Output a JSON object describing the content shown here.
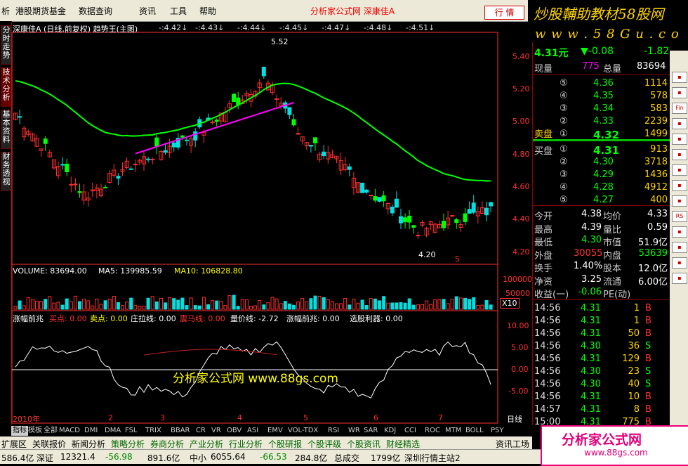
{
  "menu": {
    "items": [
      "析",
      "港股期货基金",
      "数据查询",
      "资讯",
      "工具",
      "帮助"
    ],
    "brand": "分析家公式网  深康佳A",
    "quote_button": "行 情",
    "sys_buttons": [
      "_",
      "□",
      "×"
    ]
  },
  "logo": {
    "title": "炒股輔助教材58股网",
    "url": "w w w . 5 8 G u . c o m"
  },
  "left_tabs": [
    "分时走势",
    "技术分析",
    "基本资料",
    "财务透视"
  ],
  "main_chart": {
    "header": "深康佳A (日线,前复权) 趋势王(主图)",
    "marks": [
      "-:4.42↓",
      "-:4.43↓",
      "-:4.44↓",
      "-:4.45↓",
      "-:4.47↓",
      "-:4.48↓",
      "-:4.51↓"
    ],
    "high_label": "5.52",
    "low_label": "4.20",
    "yticks": [
      "5.40",
      "5.20",
      "5.00",
      "4.80",
      "4.60",
      "4.40",
      "4.20"
    ],
    "marker": "S",
    "colors": {
      "up": "#ff3030",
      "down": "#00e0e0",
      "trend": "#00ff00",
      "ma": "#ff00ff",
      "axis": "#ff3030"
    }
  },
  "volume": {
    "title": "VOLUME: 83694.00",
    "ma5": "MA5: 139985.59",
    "ma10": "MA10: 106828.80",
    "yticks": [
      "100000",
      "50000"
    ],
    "unit": "X10"
  },
  "indicator": {
    "title": "涨幅前兆",
    "labels": [
      {
        "text": "买点: 0.00",
        "color": "#ff3030"
      },
      {
        "text": "卖点: 0.00",
        "color": "#ffff00"
      },
      {
        "text": "庄拉线: 0.00",
        "color": "#ffffff"
      },
      {
        "text": "震马线: 0.00",
        "color": "#ff3030"
      },
      {
        "text": "量价线: -2.72",
        "color": "#ffffff"
      },
      {
        "text": "涨幅前兆: 0.00",
        "color": "#ffffff"
      },
      {
        "text": "选股利器: 0.00",
        "color": "#ffffff"
      }
    ],
    "yticks": [
      "10.00",
      "5.00",
      "0.00",
      "-5.00"
    ],
    "watermark": "分析家公式网  www.88gs.com"
  },
  "xaxis": {
    "labels": [
      "2010年",
      "2",
      "3",
      "4",
      "5",
      "6",
      "7"
    ],
    "period": "日线"
  },
  "quote": {
    "price": "4.31元",
    "change": "▼-0.08",
    "pct": "-1.82",
    "cur_vol_label": "现量",
    "cur_vol": "775",
    "total_vol_label": "总量",
    "total_vol": "83694",
    "asks": [
      {
        "n": "⑤",
        "p": "4.36",
        "v": "1114"
      },
      {
        "n": "④",
        "p": "4.35",
        "v": "578"
      },
      {
        "n": "③",
        "p": "4.34",
        "v": "583"
      },
      {
        "n": "②",
        "p": "4.33",
        "v": "2239"
      },
      {
        "n": "①",
        "p": "4.32",
        "v": "1499"
      }
    ],
    "ask_label": "卖盘",
    "bid_label": "买盘",
    "bids": [
      {
        "n": "①",
        "p": "4.31",
        "v": "913"
      },
      {
        "n": "②",
        "p": "4.30",
        "v": "3718"
      },
      {
        "n": "③",
        "p": "4.29",
        "v": "1436"
      },
      {
        "n": "④",
        "p": "4.28",
        "v": "4912"
      },
      {
        "n": "⑤",
        "p": "4.27",
        "v": "400"
      }
    ],
    "stats": [
      {
        "l1": "今开",
        "v1": "4.38",
        "l2": "均价",
        "v2": "4.33"
      },
      {
        "l1": "最高",
        "v1": "4.39",
        "l2": "量比",
        "v2": "0.59"
      },
      {
        "l1": "最低",
        "v1": "4.30",
        "l2": "市值",
        "v2": "51.9亿"
      },
      {
        "l1": "外盘",
        "v1": "30055",
        "l2": "内盘",
        "v2": "53639"
      },
      {
        "l1": "换手",
        "v1": "1.40%",
        "l2": "股本",
        "v2": "12.0亿"
      },
      {
        "l1": "净资",
        "v1": "3.25",
        "l2": "流通",
        "v2": "6.00亿"
      },
      {
        "l1": "收益(一)",
        "v1": "-0.06",
        "l2": "PE(动)",
        "v2": ""
      }
    ],
    "ticks": [
      {
        "t": "14:56",
        "p": "4.31",
        "v": "1",
        "s": "B"
      },
      {
        "t": "14:56",
        "p": "4.31",
        "v": "1",
        "s": "B"
      },
      {
        "t": "14:56",
        "p": "4.31",
        "v": "50",
        "s": "B"
      },
      {
        "t": "14:56",
        "p": "4.30",
        "v": "36",
        "s": "S"
      },
      {
        "t": "14:56",
        "p": "4.31",
        "v": "129",
        "s": "B"
      },
      {
        "t": "14:56",
        "p": "4.30",
        "v": "23",
        "s": "S"
      },
      {
        "t": "14:56",
        "p": "4.30",
        "v": "40",
        "s": "S"
      },
      {
        "t": "14:56",
        "p": "4.31",
        "v": "10",
        "s": "B"
      },
      {
        "t": "14:57",
        "p": "4.31",
        "v": "8",
        "s": "B"
      },
      {
        "t": "15:00",
        "p": "4.31",
        "v": "775",
        "s": "B"
      }
    ]
  },
  "bottom_tabs": [
    "指标",
    "模板",
    "全部",
    "MACD",
    "DMI",
    "DMA",
    "FSL",
    "TRIX",
    "BBAR",
    "CR",
    "VR",
    "OBV",
    "ASI",
    "EMV",
    "VOL-TDX",
    "RSI",
    "WR",
    "SAR",
    "KDJ",
    "CCI",
    "ROC",
    "MTM",
    "BOLL",
    "PSY"
  ],
  "nav_tabs": [
    "扩展区",
    "关联报价",
    "新闻分析",
    "策略分析",
    "券商分析",
    "产业分析",
    "行业分析",
    "个股研报",
    "个股评级",
    "个股资讯",
    "财经精选"
  ],
  "nav_right": "资讯工场",
  "nav_far": "笔",
  "status": [
    "586.4亿",
    "深证",
    "12321.4",
    "-56.98",
    "891.6亿",
    "中小",
    "6055.64",
    "-66.53",
    "284.8亿",
    "总成交",
    "1799亿",
    "深圳行情主站2"
  ],
  "watermark_bottom": {
    "title": "分析家公式网",
    "url": "www.88gs.com"
  }
}
